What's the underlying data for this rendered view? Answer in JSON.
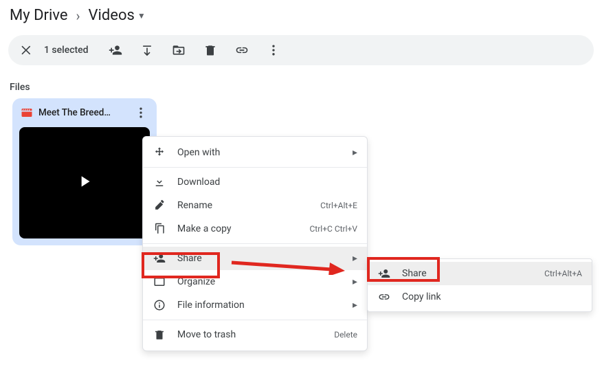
{
  "breadcrumb": {
    "root": "My Drive",
    "current": "Videos"
  },
  "actionbar": {
    "selected_text": "1 selected"
  },
  "files_section_label": "Files",
  "file": {
    "name": "Meet The Breed…"
  },
  "context_menu": {
    "open_with": "Open with",
    "download": "Download",
    "rename": "Rename",
    "rename_shortcut": "Ctrl+Alt+E",
    "make_copy": "Make a copy",
    "make_copy_shortcut": "Ctrl+C Ctrl+V",
    "share": "Share",
    "organize": "Organize",
    "file_info": "File information",
    "trash": "Move to trash",
    "trash_shortcut": "Delete"
  },
  "submenu": {
    "share": "Share",
    "share_shortcut": "Ctrl+Alt+A",
    "copy_link": "Copy link"
  }
}
